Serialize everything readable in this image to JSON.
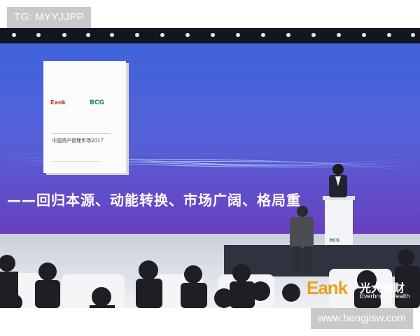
{
  "overlay": {
    "tag": "TG: MYYJJPP",
    "website": "www.hengjisw.com"
  },
  "screen": {
    "slogan": "——回归本源、动能转换、市场广阔、格局重",
    "report": {
      "brand_left": "Eank",
      "brand_right": "BCG",
      "title": "中国资产管理市场2017"
    },
    "podium_logo": "BCG"
  },
  "brand": {
    "logo_mark": "Eank",
    "name_cn": "光大理财",
    "name_en": "Everbright Wealth",
    "accent": "#e8a21c"
  },
  "colors": {
    "screen_top": "#4a5ad6",
    "screen_bottom": "#5a3fbf",
    "stage_floor": "#dcdfe8"
  }
}
